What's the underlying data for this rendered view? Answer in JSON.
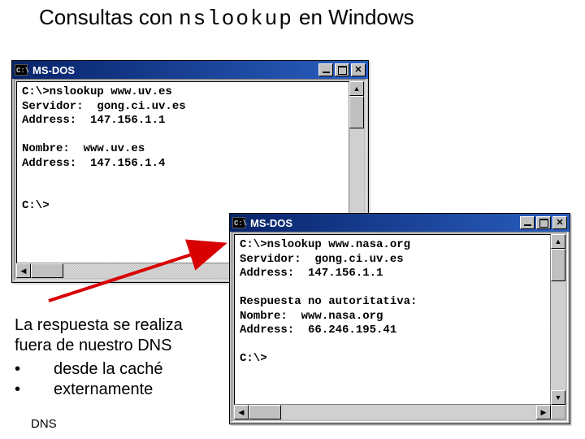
{
  "slide": {
    "title_a": "Consultas con ",
    "title_b": "nslookup",
    "title_c": " en Windows"
  },
  "win1": {
    "title": "MS-DOS",
    "icon": "C:\\",
    "lines": [
      "C:\\>nslookup www.uv.es",
      "Servidor:  gong.ci.uv.es",
      "Address:  147.156.1.1",
      "",
      "Nombre:  www.uv.es",
      "Address:  147.156.1.4",
      "",
      "",
      "C:\\>"
    ]
  },
  "win2": {
    "title": "MS-DOS",
    "icon": "C:\\",
    "lines": [
      "C:\\>nslookup www.nasa.org",
      "Servidor:  gong.ci.uv.es",
      "Address:  147.156.1.1",
      "",
      "Respuesta no autoritativa:",
      "Nombre:  www.nasa.org",
      "Address:  66.246.195.41",
      "",
      "C:\\>"
    ]
  },
  "note": {
    "l1": "La respuesta se realiza",
    "l2": "fuera de nuestro DNS",
    "b1": "desde la caché",
    "b2": "externamente"
  },
  "footer": "DNS"
}
